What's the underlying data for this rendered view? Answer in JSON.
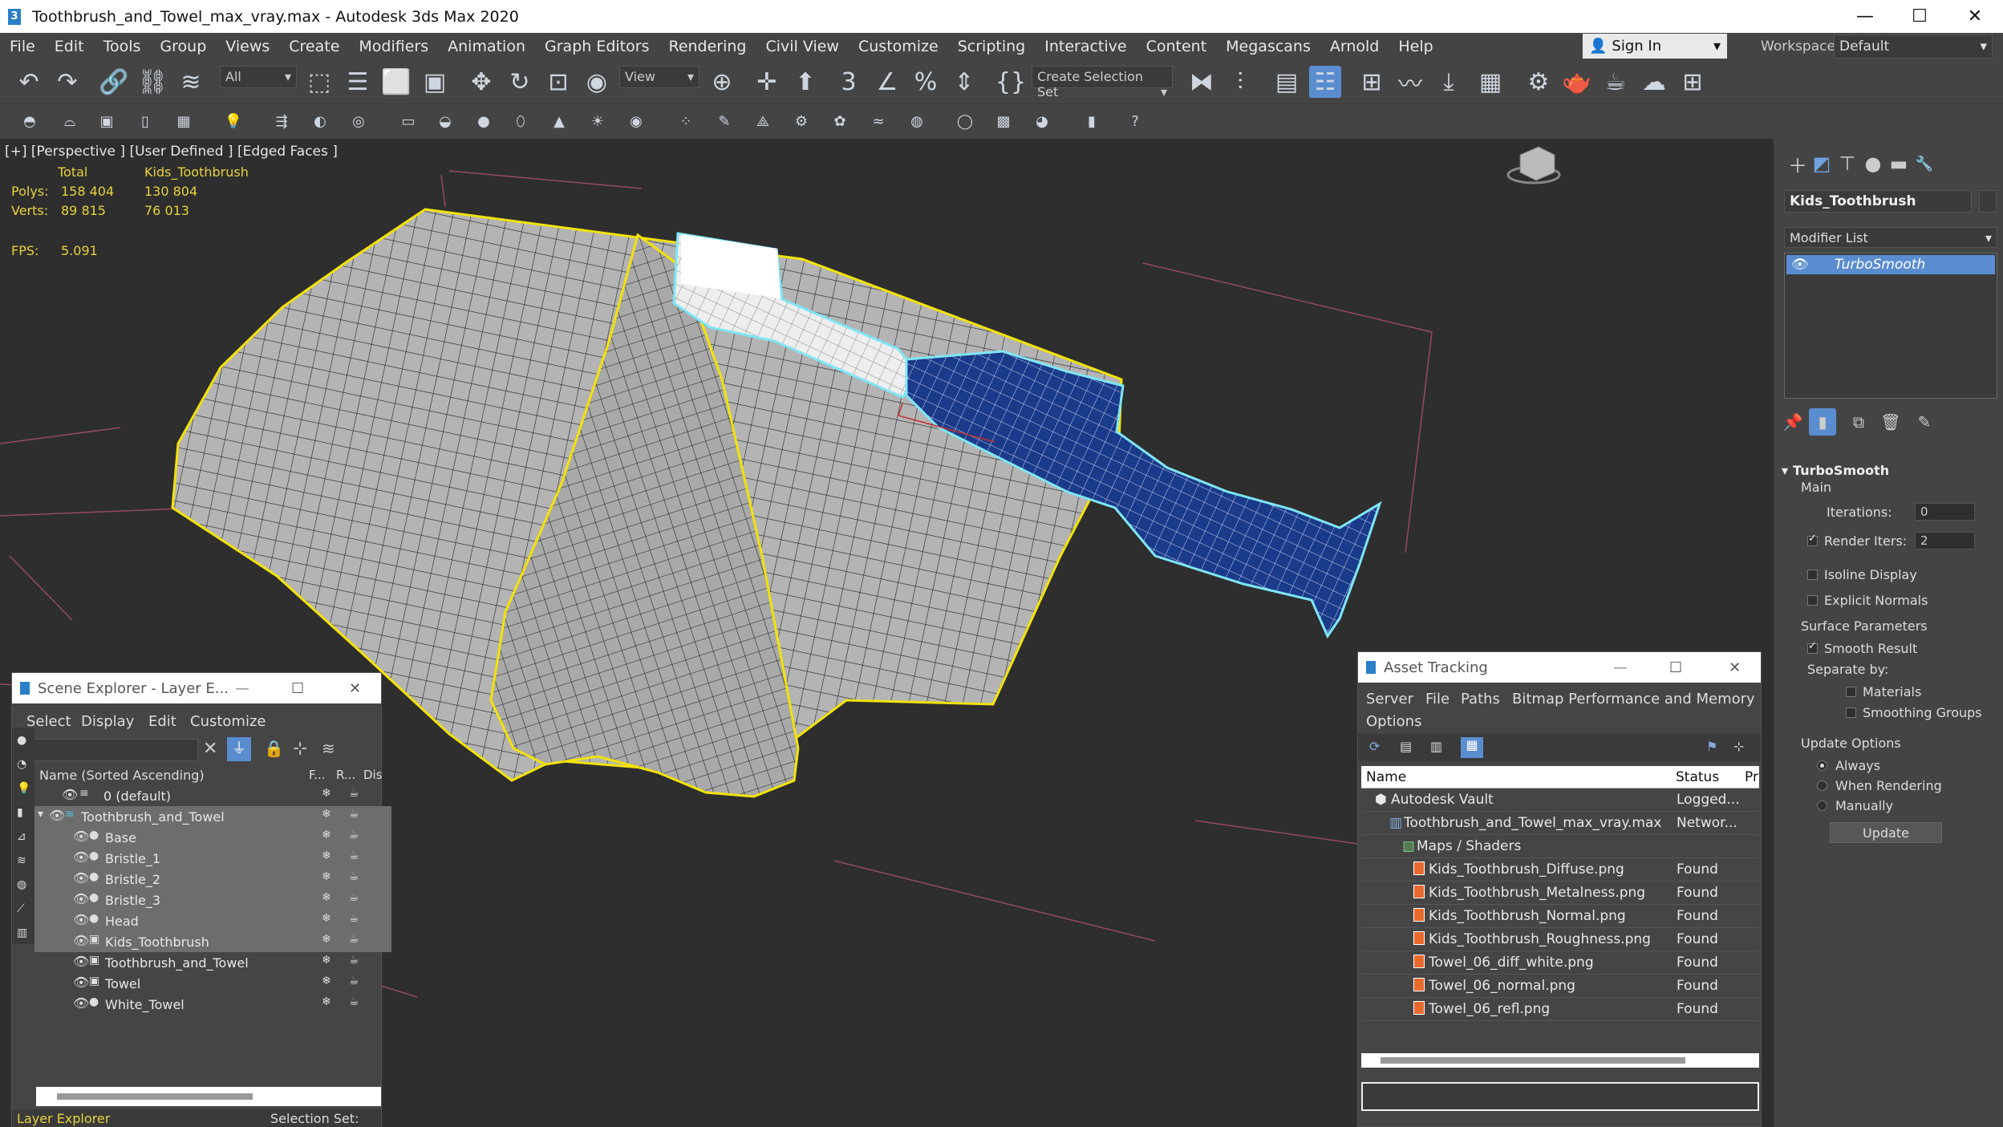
{
  "title_bar": {
    "title": "Toothbrush_and_Towel_max_vray.max - Autodesk 3ds Max 2020",
    "minimize": "—",
    "maximize": "☐",
    "close": "✕"
  },
  "menu": [
    "File",
    "Edit",
    "Tools",
    "Group",
    "Views",
    "Create",
    "Modifiers",
    "Animation",
    "Graph Editors",
    "Rendering",
    "Civil View",
    "Customize",
    "Scripting",
    "Interactive",
    "Content",
    "Megascans",
    "Arnold",
    "Help"
  ],
  "sign_in": {
    "label": "Sign In"
  },
  "workspaces": {
    "label": "Workspaces:",
    "value": "Default"
  },
  "toolbar": {
    "filter_value": "All",
    "ref_coord_value": "View",
    "selection_set_placeholder": "Create Selection Set"
  },
  "viewport": {
    "label": "[+] [Perspective ] [User Defined ] [Edged Faces ]",
    "stats": {
      "col_total": "Total",
      "col_object": "Kids_Toothbrush",
      "polys_label": "Polys:",
      "polys_total": "158 404",
      "polys_object": "130 804",
      "verts_label": "Verts:",
      "verts_total": "89 815",
      "verts_object": "76 013",
      "fps_label": "FPS:",
      "fps_value": "5.091"
    }
  },
  "command_panel": {
    "object_name": "Kids_Toothbrush",
    "modifier_list_label": "Modifier List",
    "stack_item": "TurboSmooth",
    "rollout_title": "TurboSmooth",
    "main_label": "Main",
    "iterations_label": "Iterations:",
    "iterations_value": "0",
    "render_iters_label": "Render Iters:",
    "render_iters_value": "2",
    "isoline_label": "Isoline Display",
    "explicit_normals_label": "Explicit Normals",
    "surface_params_label": "Surface Parameters",
    "smooth_result_label": "Smooth Result",
    "separate_by_label": "Separate by:",
    "materials_label": "Materials",
    "smoothing_groups_label": "Smoothing Groups",
    "update_options_label": "Update Options",
    "always_label": "Always",
    "when_rendering_label": "When Rendering",
    "manually_label": "Manually",
    "update_button": "Update"
  },
  "scene_explorer": {
    "title": "Scene Explorer - Layer E...",
    "menu": [
      "Select",
      "Display",
      "Edit",
      "Customize"
    ],
    "col_name": "Name (Sorted Ascending)",
    "col_f": "F...",
    "col_r": "R...",
    "col_dis": "Dis",
    "rows": [
      {
        "name": "0 (default)"
      },
      {
        "name": "Toothbrush_and_Towel"
      },
      {
        "name": "Base"
      },
      {
        "name": "Bristle_1"
      },
      {
        "name": "Bristle_2"
      },
      {
        "name": "Bristle_3"
      },
      {
        "name": "Head"
      },
      {
        "name": "Kids_Toothbrush"
      },
      {
        "name": "Toothbrush_and_Towel"
      },
      {
        "name": "Towel"
      },
      {
        "name": "White_Towel"
      }
    ],
    "footer_left": "Layer Explorer",
    "footer_right": "Selection Set:"
  },
  "asset_tracking": {
    "title": "Asset Tracking",
    "menu": [
      "Server",
      "File",
      "Paths",
      "Bitmap Performance and Memory",
      "Options"
    ],
    "col_name": "Name",
    "col_status": "Status",
    "col_p": "Pr",
    "rows": [
      {
        "name": "Autodesk Vault",
        "status": "Logged..."
      },
      {
        "name": "Toothbrush_and_Towel_max_vray.max",
        "status": "Networ..."
      },
      {
        "name": "Maps / Shaders",
        "status": ""
      },
      {
        "name": "Kids_Toothbrush_Diffuse.png",
        "status": "Found"
      },
      {
        "name": "Kids_Toothbrush_Metalness.png",
        "status": "Found"
      },
      {
        "name": "Kids_Toothbrush_Normal.png",
        "status": "Found"
      },
      {
        "name": "Kids_Toothbrush_Roughness.png",
        "status": "Found"
      },
      {
        "name": "Towel_06_diff_white.png",
        "status": "Found"
      },
      {
        "name": "Towel_06_normal.png",
        "status": "Found"
      },
      {
        "name": "Towel_06_refl.png",
        "status": "Found"
      }
    ]
  },
  "colors": {
    "accent": "#5a8cd0",
    "stats_yellow": "#e8d23a",
    "selection_yellow": "#f2e20c",
    "selection_cyan": "#7fe6f5",
    "handle_blue": "#1a3a8a"
  }
}
